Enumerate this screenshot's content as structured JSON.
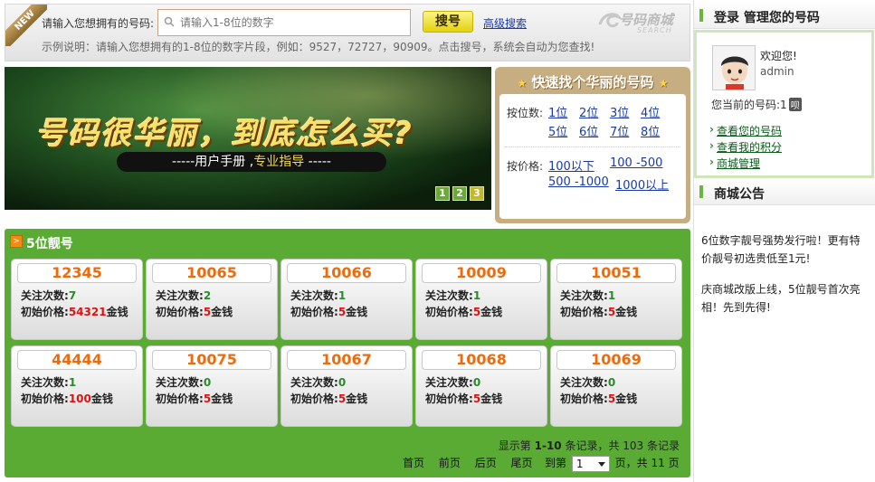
{
  "search": {
    "ribbon": "NEW",
    "label": "请输入您想拥有的号码:",
    "placeholder": "请输入1-8位的数字",
    "button": "搜号",
    "advanced": "高级搜索",
    "logo": "号码商城",
    "logo_sub": "SEARCH",
    "hint": "示例说明：请输入您想拥有的1-8位的数字片段，例如：9527，72727，90909。点击搜号，系统会自动为您查找!"
  },
  "banner": {
    "title": "号码很华丽，到底怎么买?",
    "subtitle_prefix": "-----用户手册 ,",
    "subtitle_guide": "专业指导",
    "subtitle_suffix": " -----",
    "slides": [
      "1",
      "2",
      "3"
    ],
    "active_slide": 3
  },
  "quick_find": {
    "title": "快速找个华丽的号码",
    "by_digits_label": "按位数:",
    "digits": [
      "1位",
      "2位",
      "3位",
      "4位",
      "5位",
      "6位",
      "7位",
      "8位"
    ],
    "by_price_label": "按价格:",
    "prices": [
      "100以下",
      "100 -500",
      "500 -1000",
      "1000以上"
    ]
  },
  "login": {
    "header": "登录 管理您的号码",
    "welcome": "欢迎您!",
    "username": "admin",
    "current_number_label": "您当前的号码:1",
    "current_number_badge": "呗",
    "links": [
      "查看您的号码",
      "查看我的积分",
      "商城管理"
    ]
  },
  "notice": {
    "header": "商城公告",
    "items": [
      "6位数字靓号强势发行啦！更有特价靓号初选贵低至1元!",
      "庆商城改版上线，5位靓号首次亮相！先到先得!"
    ]
  },
  "listing": {
    "title": "5位靓号",
    "follow_label": "关注次数:",
    "price_label": "初始价格:",
    "currency": "金钱",
    "cards": [
      {
        "number": "12345",
        "follows": "7",
        "price": "54321"
      },
      {
        "number": "10065",
        "follows": "2",
        "price": "5"
      },
      {
        "number": "10066",
        "follows": "1",
        "price": "5"
      },
      {
        "number": "10009",
        "follows": "1",
        "price": "5"
      },
      {
        "number": "10051",
        "follows": "1",
        "price": "5"
      },
      {
        "number": "44444",
        "follows": "1",
        "price": "100"
      },
      {
        "number": "10075",
        "follows": "0",
        "price": "5"
      },
      {
        "number": "10067",
        "follows": "0",
        "price": "5"
      },
      {
        "number": "10068",
        "follows": "0",
        "price": "5"
      },
      {
        "number": "10069",
        "follows": "0",
        "price": "5"
      }
    ],
    "pager_info": {
      "prefix": "显示第 ",
      "range": "1-10",
      "middle": " 条记录，共 103 条记录"
    },
    "pager_links": [
      "首页",
      "前页",
      "后页",
      "尾页"
    ],
    "jump_prefix": "到第",
    "jump_value": "1",
    "jump_suffix": "页，共 11 页"
  },
  "colors": {
    "accent_green": "#5aab34",
    "number_orange": "#f06a0a",
    "price_red": "#e01010",
    "link_blue": "#1a3aa8"
  }
}
